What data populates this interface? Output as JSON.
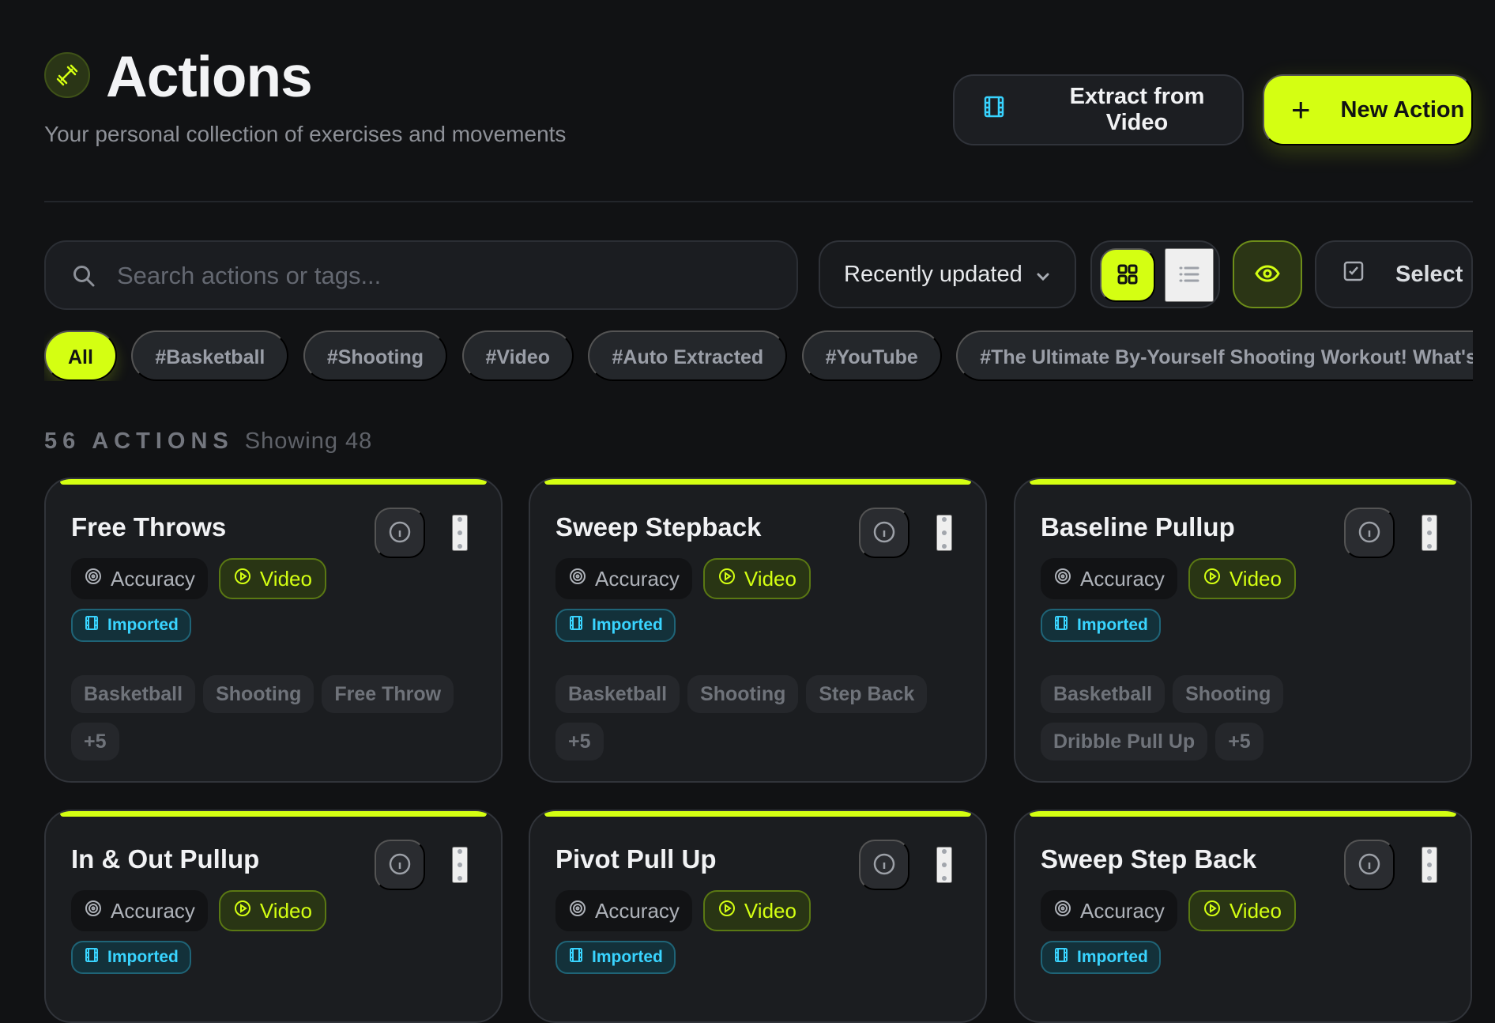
{
  "header": {
    "title": "Actions",
    "subtitle": "Your personal collection of exercises and movements",
    "extract_label": "Extract from Video",
    "new_label": "New Action"
  },
  "toolbar": {
    "search_placeholder": "Search actions or tags...",
    "sort_label": "Recently updated",
    "select_label": "Select"
  },
  "filters": [
    "All",
    "#Basketball",
    "#Shooting",
    "#Video",
    "#Auto Extracted",
    "#YouTube",
    "#The Ultimate By-Yourself Shooting Workout! What's Y"
  ],
  "summary": {
    "count_label": "56 ACTIONS",
    "showing_label": "Showing 48"
  },
  "cards": [
    {
      "title": "Free Throws",
      "badge1": "Accuracy",
      "badge2": "Video",
      "imported": "Imported",
      "tags": [
        "Basketball",
        "Shooting",
        "Free Throw",
        "+5"
      ]
    },
    {
      "title": "Sweep Stepback",
      "badge1": "Accuracy",
      "badge2": "Video",
      "imported": "Imported",
      "tags": [
        "Basketball",
        "Shooting",
        "Step Back",
        "+5"
      ]
    },
    {
      "title": "Baseline Pullup",
      "badge1": "Accuracy",
      "badge2": "Video",
      "imported": "Imported",
      "tags": [
        "Basketball",
        "Shooting",
        "Dribble Pull Up",
        "+5"
      ]
    },
    {
      "title": "In & Out Pullup",
      "badge1": "Accuracy",
      "badge2": "Video",
      "imported": "Imported",
      "tags": []
    },
    {
      "title": "Pivot Pull Up",
      "badge1": "Accuracy",
      "badge2": "Video",
      "imported": "Imported",
      "tags": []
    },
    {
      "title": "Sweep Step Back",
      "badge1": "Accuracy",
      "badge2": "Video",
      "imported": "Imported",
      "tags": []
    }
  ],
  "icons": {
    "logo": "dumbbell-icon",
    "extract": "film-icon",
    "new": "plus-icon",
    "search": "search-icon",
    "sort": "chevron-down-icon",
    "grid": "grid-icon",
    "list": "list-icon",
    "visibility": "eye-icon",
    "select": "checkbox-icon",
    "accuracy": "target-icon",
    "video": "play-circle-icon",
    "imported": "film-icon",
    "info": "info-icon",
    "more": "more-vertical-icon"
  },
  "colors": {
    "accent": "#d4ff12",
    "background": "#111214",
    "card": "#1b1d20",
    "imported": "#39d4ff"
  }
}
